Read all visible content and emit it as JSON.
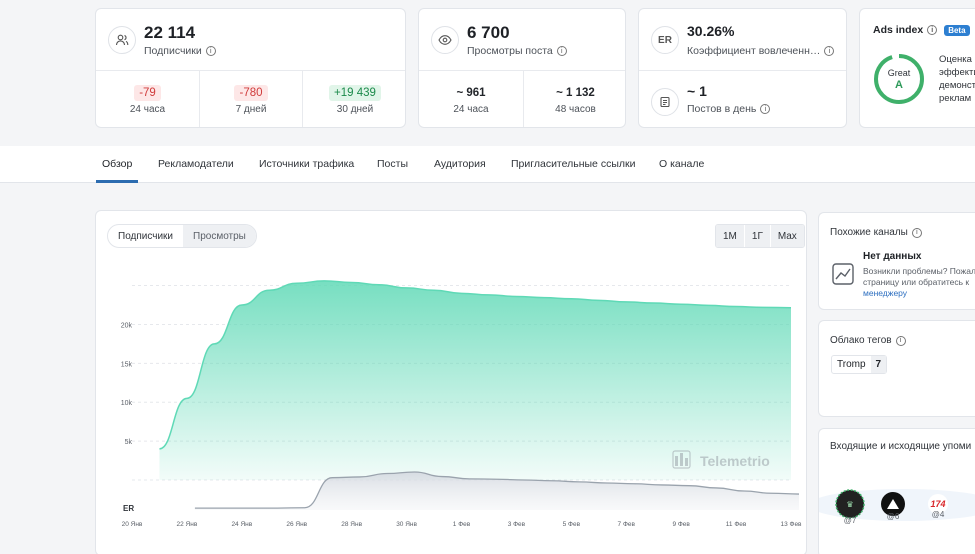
{
  "stats": {
    "subscribers": {
      "value": "22 114",
      "label": "Подписчики",
      "cells": [
        {
          "value": "-79",
          "label": "24 часа",
          "kind": "neg"
        },
        {
          "value": "-780",
          "label": "7 дней",
          "kind": "neg"
        },
        {
          "value": "+19 439",
          "label": "30 дней",
          "kind": "pos"
        }
      ]
    },
    "views": {
      "value": "6 700",
      "label": "Просмотры поста",
      "cells": [
        {
          "value": "~ 961",
          "label": "24 часа"
        },
        {
          "value": "~ 1 132",
          "label": "48 часов"
        }
      ]
    },
    "er": {
      "icon_text": "ER",
      "value": "30.26%",
      "label": "Коэффициент вовлеченн…",
      "posts_value": "~ 1",
      "posts_label": "Постов в день"
    },
    "ads": {
      "title": "Ads index",
      "badge": "Beta",
      "grade_word": "Great",
      "grade_letter": "A",
      "grade_fraction": 0.95,
      "text_lines": [
        "Оценка",
        "эффекти",
        "демонст",
        "реклам"
      ]
    }
  },
  "tabs": [
    "Обзор",
    "Рекламодатели",
    "Источники трафика",
    "Посты",
    "Аудитория",
    "Пригласительные ссылки",
    "О канале"
  ],
  "active_tab": "Обзор",
  "chart": {
    "toggle": [
      "Подписчики",
      "Просмотры"
    ],
    "ranges": [
      "1M",
      "1Г",
      "Max"
    ],
    "watermark": "Telemetrio",
    "er_label": "ER"
  },
  "chart_data": {
    "type": "area",
    "x": [
      "20 Янв",
      "21 Янв",
      "22 Янв",
      "23 Янв",
      "24 Янв",
      "25 Янв",
      "26 Янв",
      "27 Янв",
      "28 Янв",
      "29 Янв",
      "30 Янв",
      "31 Янв",
      "1 Фев",
      "2 Фев",
      "3 Фев",
      "4 Фев",
      "5 Фев",
      "6 Фев",
      "7 Фев",
      "8 Фев",
      "9 Фев",
      "10 Фев",
      "11 Фев",
      "12 Фев",
      "13 Фев"
    ],
    "x_tick_labels": [
      "20 Янв",
      "22 Янв",
      "24 Янв",
      "26 Янв",
      "28 Янв",
      "30 Янв",
      "1 Фев",
      "3 Фев",
      "5 Фев",
      "7 Фев",
      "9 Фев",
      "11 Фев",
      "13 Фев"
    ],
    "y_tick_labels": [
      "5k",
      "10k",
      "15k",
      "20k"
    ],
    "ylim": [
      0,
      27000
    ],
    "series": [
      {
        "color": "#5fd9b6",
        "values": [
          null,
          4000,
          10500,
          17500,
          22500,
          24400,
          25300,
          25600,
          25400,
          25100,
          24700,
          24400,
          24000,
          23800,
          23600,
          23450,
          23300,
          23100,
          22900,
          22750,
          22600,
          22450,
          22300,
          22200,
          22150
        ]
      }
    ],
    "er_series": {
      "color": "#9aa3ad",
      "values": [
        null,
        null,
        0.05,
        0.05,
        0.05,
        0.05,
        0.06,
        0.85,
        0.87,
        0.96,
        1.0,
        0.88,
        0.82,
        0.81,
        0.79,
        0.77,
        0.74,
        0.71,
        0.69,
        0.66,
        0.64,
        0.58,
        0.5,
        0.44,
        0.42
      ]
    }
  },
  "sidebar": {
    "similar": {
      "title": "Похожие каналы",
      "no_data": "Нет данных",
      "text1": "Возникли проблемы? Пожал",
      "text2": "страницу или обратитесь к",
      "link": "менеджеру"
    },
    "tags": {
      "title": "Облако тегов",
      "items": [
        {
          "name": "Tromp",
          "count": "7"
        }
      ]
    },
    "mentions": {
      "title": "Входящие и исходящие упоми",
      "items": [
        {
          "label": "@7"
        },
        {
          "label": "@6"
        },
        {
          "label": "@4",
          "logo_text": "174"
        }
      ]
    }
  }
}
